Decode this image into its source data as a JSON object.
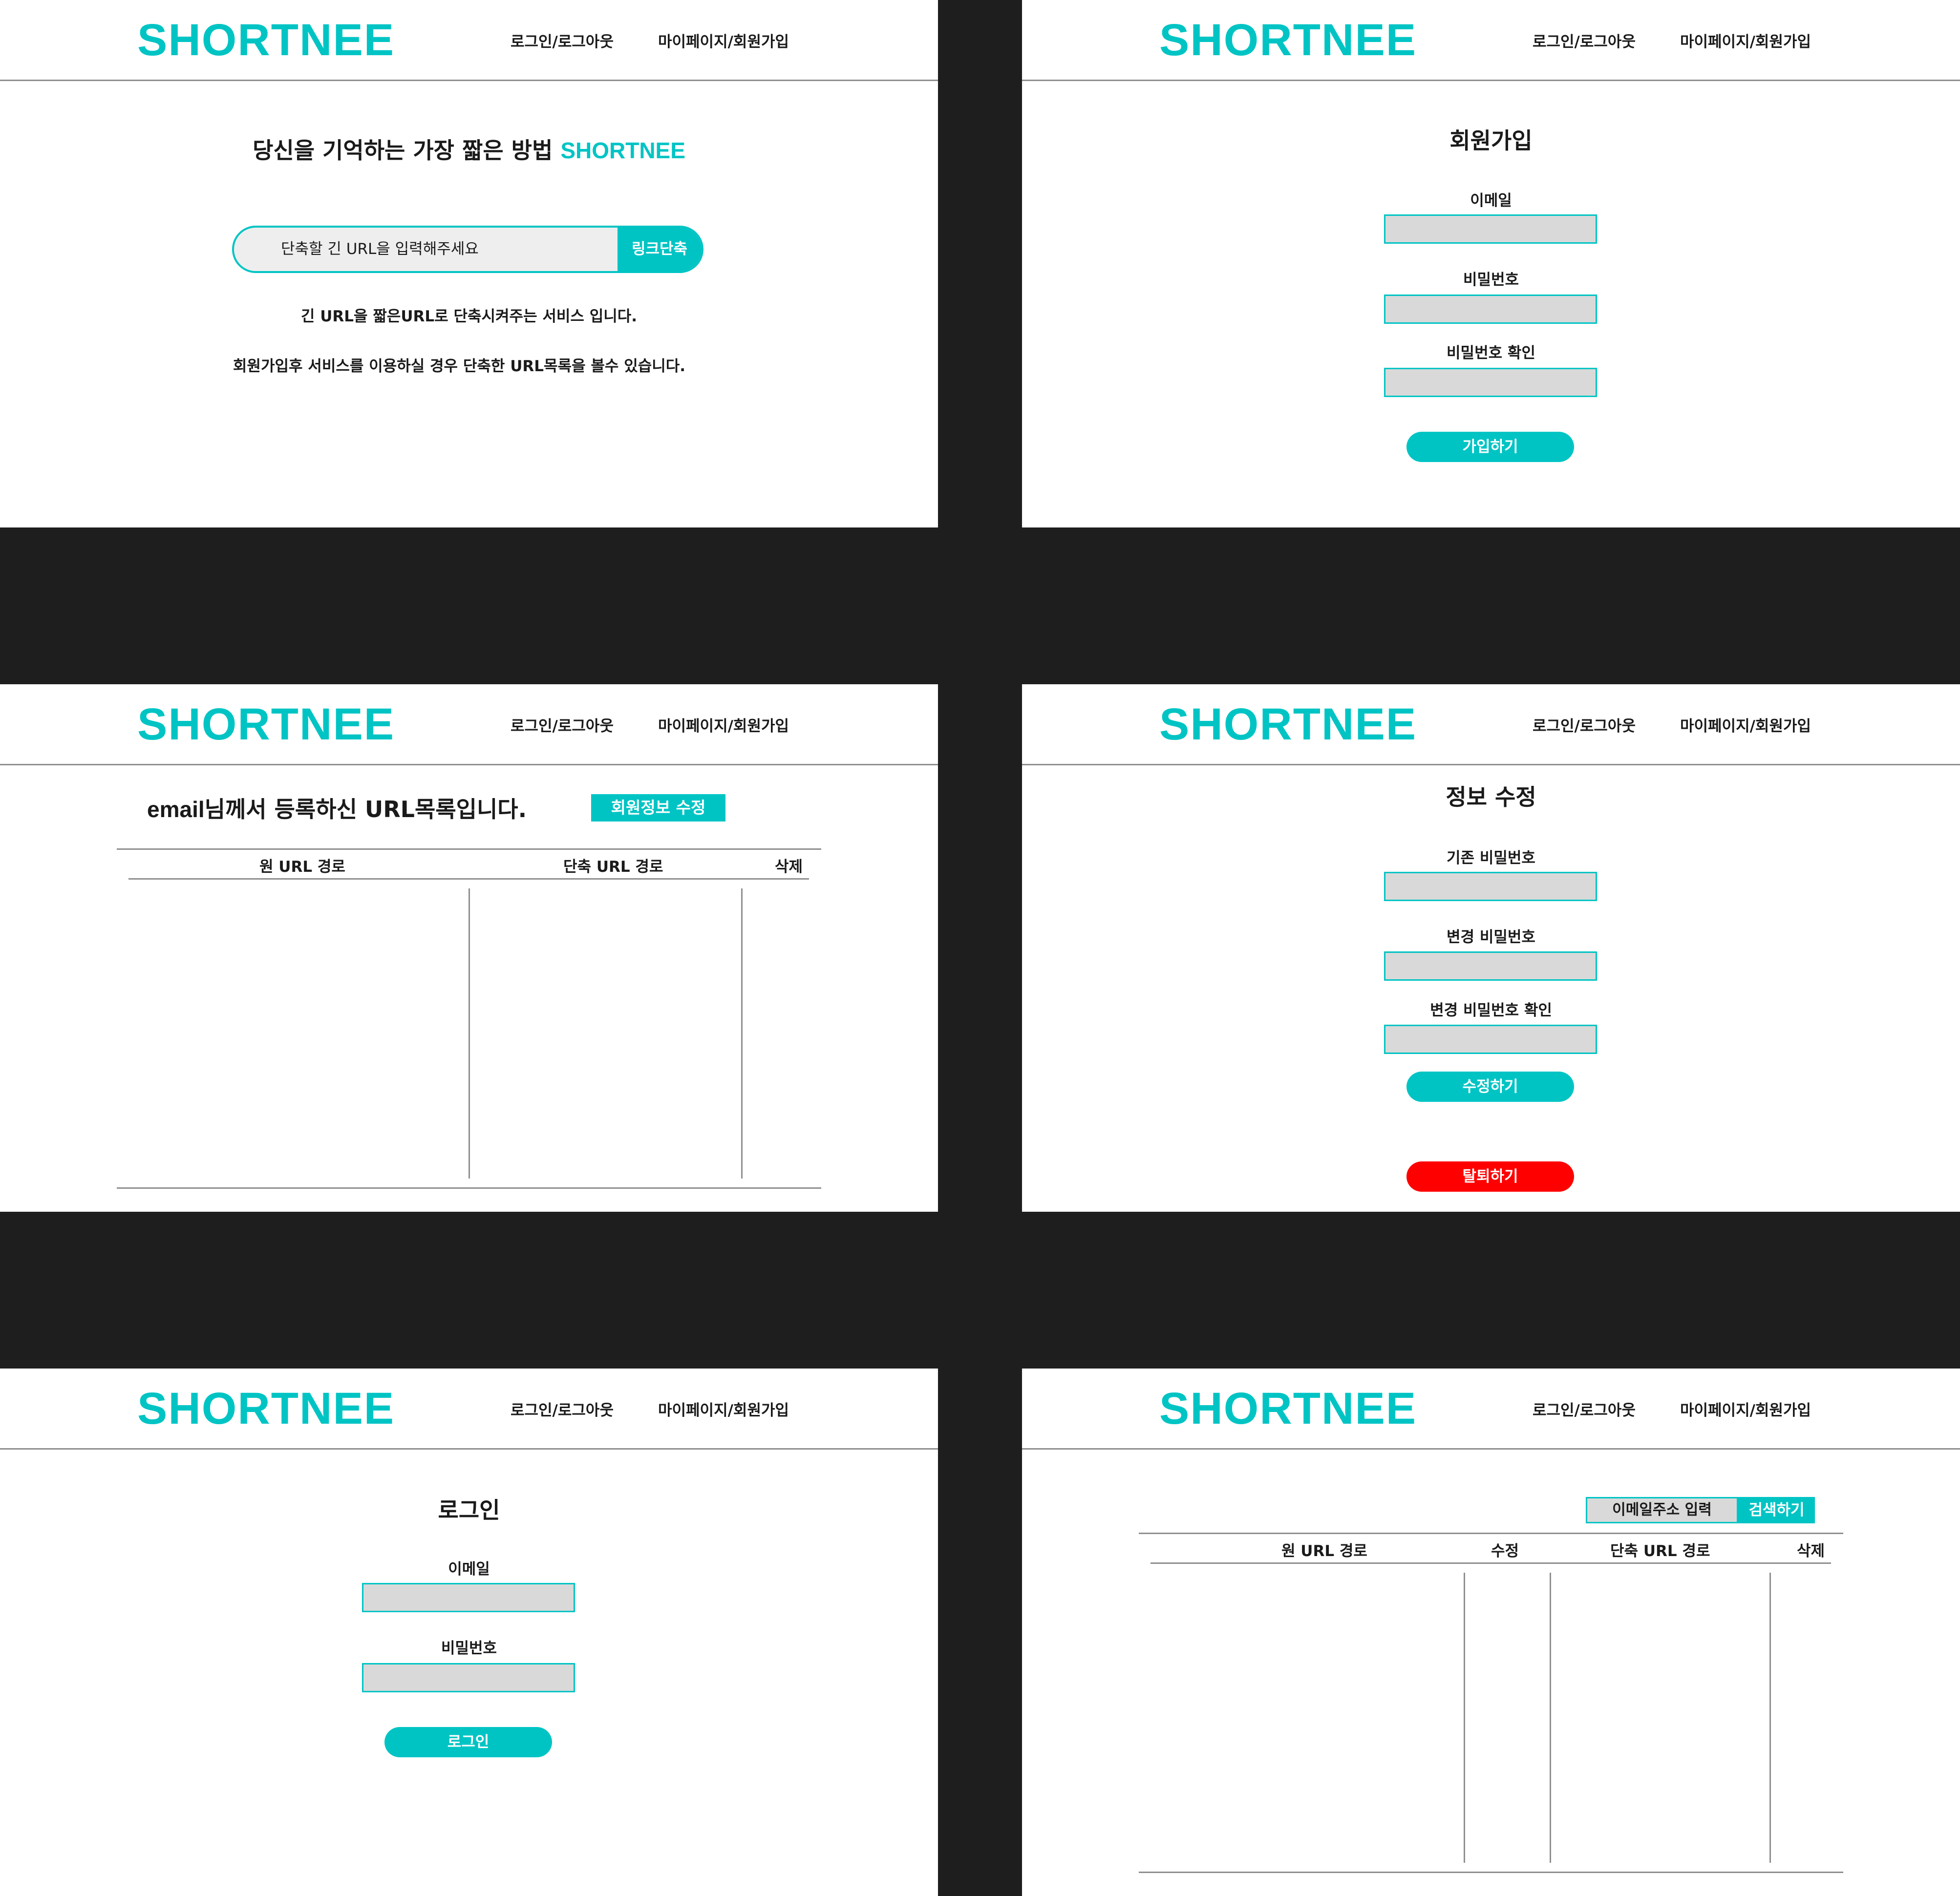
{
  "brand": {
    "logo": "SHORTNEE",
    "nav_login": "로그인/로그아웃",
    "nav_mypage": "마이페이지/회원가입"
  },
  "colors": {
    "accent": "#00c4c4",
    "danger": "#ff0000",
    "field_bg": "#d9d9d9",
    "divider": "#8f8f8f",
    "backdrop": "#1e1e1e"
  },
  "home": {
    "slogan": "당신을 기억하는 가장 짧은 방법 ",
    "slogan_brand": "SHORTNEE",
    "url_placeholder": "단축할 긴 URL을 입력해주세요",
    "shorten_button": "링크단축",
    "desc1": "긴  URL을 짧은URL로 단축시켜주는 서비스 입니다.",
    "desc2": "회원가입후 서비스를 이용하실 경우 단축한  URL목록을 볼수 있습니다."
  },
  "signup": {
    "title": "회원가입",
    "email_label": "이메일",
    "password_label": "비밀번호",
    "password_confirm_label": "비밀번호 확인",
    "submit": "가입하기"
  },
  "mylist": {
    "title_email": "email",
    "title_rest": "님께서 등록하신 URL목록입니다.",
    "edit_button": "회원정보 수정",
    "columns": [
      "원 URL 경로",
      "단축 URL 경로",
      "삭제"
    ]
  },
  "edit": {
    "title": "정보 수정",
    "current_password_label": "기존 비밀번호",
    "new_password_label": "변경 비밀번호",
    "new_password_confirm_label": "변경 비밀번호 확인",
    "submit": "수정하기",
    "withdraw": "탈퇴하기"
  },
  "login": {
    "title": "로그인",
    "email_label": "이메일",
    "password_label": "비밀번호",
    "submit": "로그인"
  },
  "admin": {
    "search_placeholder": "이메일주소 입력",
    "search_button": "검색하기",
    "columns": [
      "원 URL 경로",
      "수정",
      "단축 URL 경로",
      "삭제"
    ]
  }
}
